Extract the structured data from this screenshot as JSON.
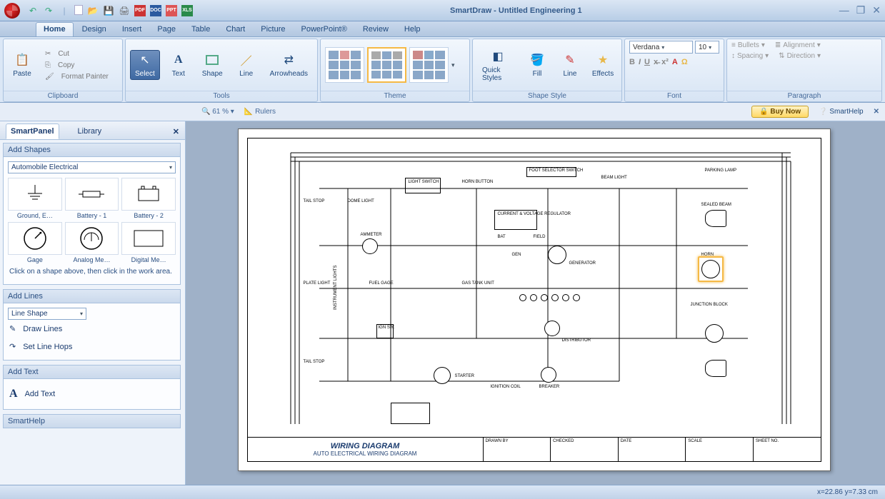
{
  "app": {
    "title": "SmartDraw - Untitled Engineering 1"
  },
  "qat_icons": [
    "undo",
    "redo",
    "sep",
    "new",
    "open",
    "save",
    "print",
    "pdf",
    "doc",
    "ppt",
    "xls"
  ],
  "tabs": [
    "Home",
    "Design",
    "Insert",
    "Page",
    "Table",
    "Chart",
    "Picture",
    "PowerPoint®",
    "Review",
    "Help"
  ],
  "active_tab": "Home",
  "ribbon": {
    "clipboard": {
      "label": "Clipboard",
      "paste": "Paste",
      "cut": "Cut",
      "copy": "Copy",
      "fmt": "Format Painter"
    },
    "tools": {
      "label": "Tools",
      "select": "Select",
      "text": "Text",
      "shape": "Shape",
      "line": "Line",
      "arrow": "Arrowheads"
    },
    "theme": {
      "label": "Theme"
    },
    "style": {
      "label": "Shape Style",
      "quick": "Quick Styles",
      "fill": "Fill",
      "line": "Line",
      "effects": "Effects"
    },
    "font": {
      "label": "Font",
      "family": "Verdana",
      "size": "10"
    },
    "para": {
      "label": "Paragraph",
      "bullets": "Bullets",
      "align": "Alignment",
      "spacing": "Spacing",
      "dir": "Direction"
    }
  },
  "viewbar": {
    "zoom": "61 %",
    "rulers": "Rulers",
    "buy": "Buy Now",
    "help": "SmartHelp"
  },
  "sidepanel": {
    "tabs": {
      "panel": "SmartPanel",
      "library": "Library"
    },
    "addshapes": {
      "hd": "Add Shapes",
      "combo": "Automobile Electrical",
      "shapes": [
        "Ground, E…",
        "Battery - 1",
        "Battery - 2",
        "Gage",
        "Analog Me…",
        "Digital Me…"
      ],
      "hint": "Click on a shape above, then click in the work area."
    },
    "addlines": {
      "hd": "Add Lines",
      "combo": "Line Shape",
      "draw": "Draw Lines",
      "hops": "Set Line Hops"
    },
    "addtext": {
      "hd": "Add Text",
      "add": "Add Text"
    },
    "smarthelp": "SmartHelp"
  },
  "drawing": {
    "title1": "WIRING DIAGRAM",
    "title2": "AUTO ELECTRICAL WIRING DIAGRAM",
    "tb": [
      "DRAWN BY",
      "CHECKED",
      "DATE",
      "SCALE",
      "SHEET NO."
    ],
    "labels": {
      "light_switch": "LIGHT\nSWITCH",
      "horn_button": "HORN BUTTON",
      "foot_sel": "FOOT SELECTOR\nSWITCH",
      "beam": "BEAM\nLIGHT",
      "parking": "PARKING LAMP",
      "sealed": "SEALED BEAM",
      "horn": "HORN",
      "tail_stop1": "TAIL\nSTOP",
      "dome": "DOME\nLIGHT",
      "cvr": "CURRENT &\nVOLTAGE\nREGULATOR",
      "bat": "BAT",
      "field": "FIELD",
      "gen": "GEN",
      "generator": "GENERATOR",
      "ammeter": "AMMETER",
      "plate": "PLATE\nLIGHT",
      "fuel": "FUEL GAGE",
      "gastank": "GAS TANK UNIT",
      "junction": "JUNCTION BLOCK",
      "instr": "INSTRUMENT LIGHTS",
      "ign": "IGN\nSW.",
      "distributor": "DISTRIBUTOR",
      "tail_stop2": "TAIL\nSTOP",
      "starter": "STARTER",
      "ignition_coil": "IGNITION\nCOIL",
      "breaker": "BREAKER"
    }
  },
  "status": {
    "coords": "x=22.86  y=7.33 cm"
  }
}
